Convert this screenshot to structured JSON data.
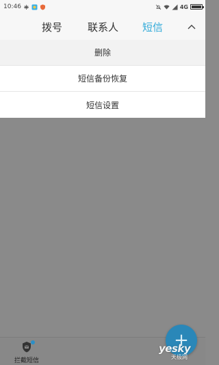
{
  "status_bar": {
    "time": "10:46",
    "network": "4G",
    "left_icons": [
      "usb-icon",
      "app-notification-icon",
      "shield-notification-icon"
    ],
    "right_icons": [
      "alarm-off-icon",
      "wifi-icon",
      "signal-icon",
      "battery-icon"
    ]
  },
  "tabs": [
    {
      "label": "拨号",
      "active": false
    },
    {
      "label": "联系人",
      "active": false
    },
    {
      "label": "短信",
      "active": true
    }
  ],
  "accent_color": "#2fa9d8",
  "menu": {
    "items": [
      {
        "label": "删除"
      },
      {
        "label": "短信备份恢复"
      },
      {
        "label": "短信设置"
      }
    ]
  },
  "bottom_bar": {
    "intercept_label": "拦截短信"
  },
  "fab": {
    "icon": "plus-icon"
  },
  "watermark": {
    "main": "yesky",
    "sub": "天极网"
  }
}
